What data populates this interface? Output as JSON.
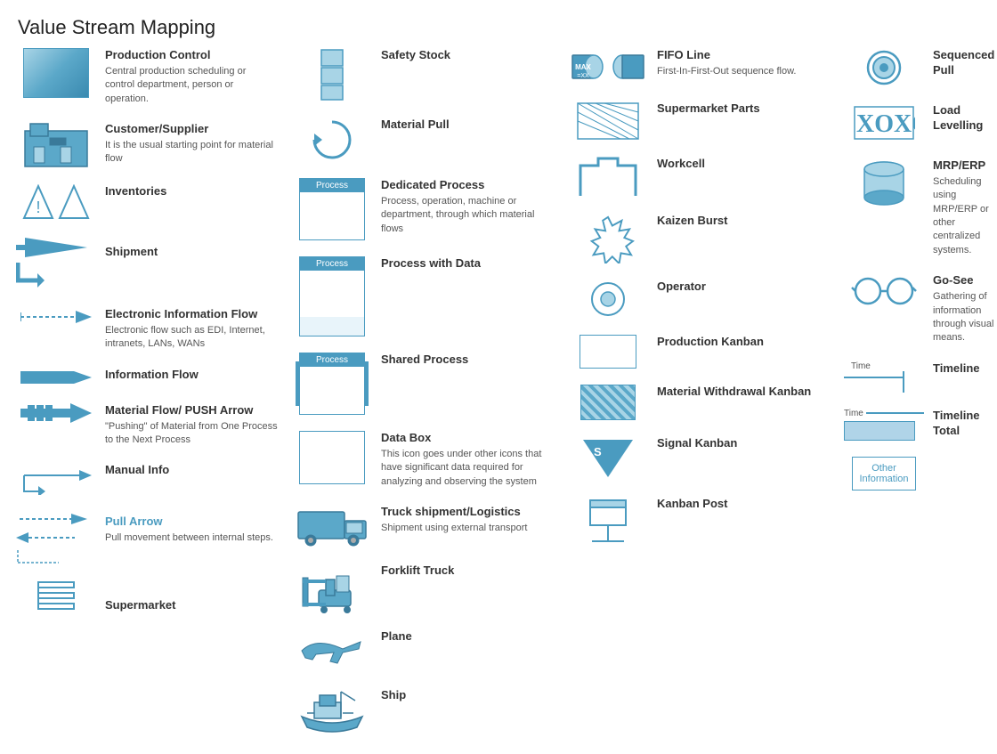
{
  "title": "Value Stream Mapping",
  "columns": [
    {
      "items": [
        {
          "id": "production-control",
          "label": "Production Control",
          "desc": "Central production scheduling or control department, person or operation.",
          "icon": "production-control-icon"
        },
        {
          "id": "customer-supplier",
          "label": "Customer/Supplier",
          "desc": "It is the usual starting point for material flow",
          "icon": "customer-supplier-icon"
        },
        {
          "id": "inventories",
          "label": "Inventories",
          "desc": "",
          "icon": "inventories-icon"
        },
        {
          "id": "shipment",
          "label": "Shipment",
          "desc": "",
          "icon": "shipment-icon"
        },
        {
          "id": "electronic-info-flow",
          "label": "Electronic Information Flow",
          "desc": "Electronic flow such as EDI, Internet, intranets, LANs, WANs",
          "icon": "electronic-info-icon"
        },
        {
          "id": "information-flow",
          "label": "Information Flow",
          "desc": "",
          "icon": "information-flow-icon"
        },
        {
          "id": "material-flow-push",
          "label": "Material Flow/ PUSH Arrow",
          "desc": "\"Pushing\" of Material from One Process to the Next Process",
          "icon": "material-flow-push-icon"
        },
        {
          "id": "manual-info",
          "label": "Manual Info",
          "desc": "",
          "icon": "manual-info-icon"
        },
        {
          "id": "pull-arrow",
          "label": "Pull Arrow",
          "desc": "Pull movement between internal steps.",
          "icon": "pull-arrow-icon"
        },
        {
          "id": "supermarket",
          "label": "Supermarket",
          "desc": "",
          "icon": "supermarket-icon"
        }
      ]
    },
    {
      "items": [
        {
          "id": "safety-stock",
          "label": "Safety Stock",
          "desc": "",
          "icon": "safety-stock-icon"
        },
        {
          "id": "material-pull",
          "label": "Material Pull",
          "desc": "",
          "icon": "material-pull-icon"
        },
        {
          "id": "dedicated-process",
          "label": "Dedicated Process",
          "desc": "Process, operation, machine or department, through which material flows",
          "icon": "dedicated-process-icon"
        },
        {
          "id": "process-with-data",
          "label": "Process with Data",
          "desc": "",
          "icon": "process-data-icon"
        },
        {
          "id": "shared-process",
          "label": "Shared Process",
          "desc": "",
          "icon": "shared-process-icon"
        },
        {
          "id": "data-box",
          "label": "Data Box",
          "desc": "This icon goes under other icons that have significant data required for analyzing and observing the system",
          "icon": "data-box-icon"
        },
        {
          "id": "truck-shipment",
          "label": "Truck shipment/Logistics",
          "desc": "Shipment using external transport",
          "icon": "truck-icon"
        },
        {
          "id": "forklift-truck",
          "label": "Forklift Truck",
          "desc": "",
          "icon": "forklift-icon"
        },
        {
          "id": "plane",
          "label": "Plane",
          "desc": "",
          "icon": "plane-icon"
        },
        {
          "id": "ship",
          "label": "Ship",
          "desc": "",
          "icon": "ship-icon"
        }
      ]
    },
    {
      "items": [
        {
          "id": "fifo-line",
          "label": "FIFO Line",
          "desc": "First-In-First-Out sequence flow.",
          "icon": "fifo-icon"
        },
        {
          "id": "supermarket-parts",
          "label": "Supermarket Parts",
          "desc": "",
          "icon": "supermarket-parts-icon"
        },
        {
          "id": "workcell",
          "label": "Workcell",
          "desc": "",
          "icon": "workcell-icon"
        },
        {
          "id": "kaizen-burst",
          "label": "Kaizen Burst",
          "desc": "",
          "icon": "kaizen-burst-icon"
        },
        {
          "id": "operator",
          "label": "Operator",
          "desc": "",
          "icon": "operator-icon"
        },
        {
          "id": "production-kanban",
          "label": "Production Kanban",
          "desc": "",
          "icon": "production-kanban-icon"
        },
        {
          "id": "material-withdrawal-kanban",
          "label": "Material Withdrawal Kanban",
          "desc": "",
          "icon": "material-withdrawal-icon"
        },
        {
          "id": "signal-kanban",
          "label": "Signal Kanban",
          "desc": "",
          "icon": "signal-kanban-icon"
        },
        {
          "id": "kanban-post",
          "label": "Kanban Post",
          "desc": "",
          "icon": "kanban-post-icon"
        }
      ]
    },
    {
      "items": [
        {
          "id": "sequenced-pull",
          "label": "Sequenced Pull",
          "desc": "",
          "icon": "sequenced-pull-icon"
        },
        {
          "id": "load-levelling",
          "label": "Load Levelling",
          "desc": "",
          "icon": "load-levelling-icon"
        },
        {
          "id": "mrp-erp",
          "label": "MRP/ERP",
          "desc": "Scheduling using MRP/ERP or other centralized systems.",
          "icon": "mrp-erp-icon"
        },
        {
          "id": "go-see",
          "label": "Go-See",
          "desc": "Gathering of information through visual means.",
          "icon": "go-see-icon"
        },
        {
          "id": "timeline",
          "label": "Timeline",
          "desc": "",
          "icon": "timeline-icon"
        },
        {
          "id": "timeline-total",
          "label": "Timeline Total",
          "desc": "",
          "icon": "timeline-total-icon"
        },
        {
          "id": "other-information",
          "label": "Other Information",
          "desc": "",
          "icon": "other-info-icon"
        }
      ]
    }
  ]
}
